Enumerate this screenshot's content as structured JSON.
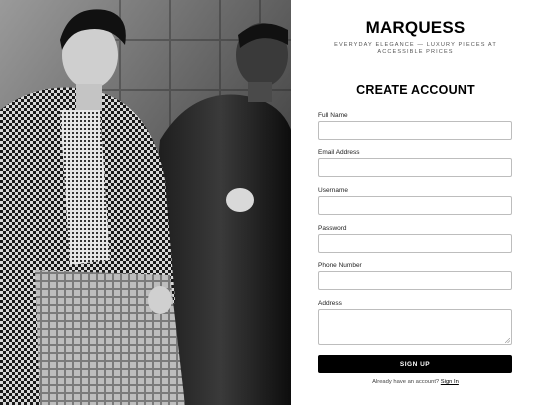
{
  "brand": "MARQUESS",
  "tagline": "EVERYDAY ELEGANCE — LUXURY PIECES AT ACCESSIBLE PRICES",
  "heading": "CREATE ACCOUNT",
  "fields": [
    {
      "label": "Full Name",
      "value": ""
    },
    {
      "label": "Email Address",
      "value": ""
    },
    {
      "label": "Username",
      "value": ""
    },
    {
      "label": "Password",
      "value": ""
    },
    {
      "label": "Phone Number",
      "value": ""
    },
    {
      "label": "Address",
      "value": ""
    }
  ],
  "submit_label": "SIGN UP",
  "footer": {
    "prompt": "Already have an account?",
    "link": "Sign In"
  },
  "colors": {
    "button_bg": "#000000",
    "field_border": "#bdbdbd"
  }
}
